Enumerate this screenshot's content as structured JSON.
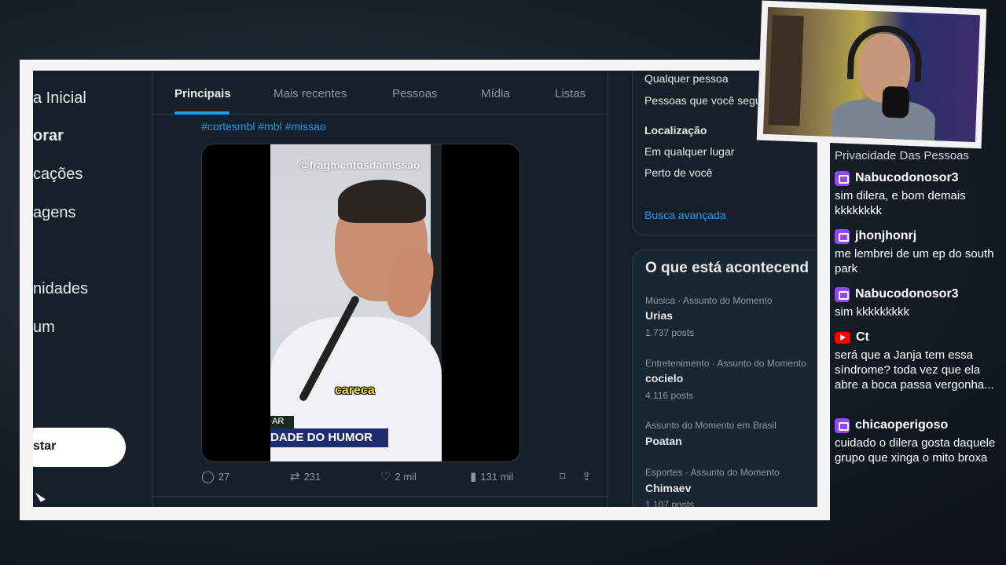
{
  "nav": {
    "items": [
      {
        "label": "a Inicial"
      },
      {
        "label": "orar"
      },
      {
        "label": "cações"
      },
      {
        "label": "agens"
      },
      {
        "label": "nidades"
      },
      {
        "label": "um"
      }
    ],
    "post_label": "star"
  },
  "tabs": [
    {
      "label": "Principais"
    },
    {
      "label": "Mais recentes"
    },
    {
      "label": "Pessoas"
    },
    {
      "label": "Mídia"
    },
    {
      "label": "Listas"
    }
  ],
  "post": {
    "hashtags": "#cortesmbl #mbl #missao",
    "video": {
      "watermark": "@fragmentosdamissao",
      "caption": "careca",
      "lower_small": "AR",
      "lower_bar": "DADE DO HUMOR"
    },
    "replies": "27",
    "reposts": "231",
    "likes": "2 mil",
    "views": "131 mil"
  },
  "filters": {
    "people_any": "Qualquer pessoa",
    "people_follow": "Pessoas que você segu",
    "location_heading": "Localização",
    "location_any": "Em qualquer lugar",
    "location_near": "Perto de você",
    "advanced": "Busca avançada"
  },
  "trends": {
    "title": "O que está acontecend",
    "items": [
      {
        "meta": "Música · Assunto do Momento",
        "name": "Urias",
        "count": "1.737 posts"
      },
      {
        "meta": "Entretenimento · Assunto do Momento",
        "name": "cocielo",
        "count": "4.116 posts"
      },
      {
        "meta": "Assunto do Momento em Brasil",
        "name": "Poatan",
        "count": ""
      },
      {
        "meta": "Esportes · Assunto do Momento",
        "name": "Chimaev",
        "count": "1.107 posts"
      }
    ]
  },
  "chat": {
    "cut_line": "Privacidade Das Pessoas",
    "messages": [
      {
        "author": "Nabucodonosor3",
        "text": "sim dilera, e bom demais kkkkkkkk",
        "platform": "twitch"
      },
      {
        "author": "jhonjhonrj",
        "text": "me lembrei de um ep do south park",
        "platform": "twitch"
      },
      {
        "author": "Nabucodonosor3",
        "text": "sim kkkkkkkkk",
        "platform": "twitch"
      },
      {
        "author": "Ct",
        "text": "será que a Janja tem essa síndrome? toda vez que ela abre a boca passa vergonha...",
        "platform": "youtube"
      },
      {
        "author": "chicaoperigoso",
        "text": "cuidado o dilera gosta daquele grupo que xinga o mito broxa",
        "platform": "twitch"
      }
    ]
  },
  "colors": {
    "accent": "#1d9bf0",
    "background": "#15202b",
    "twitch": "#9146ff",
    "youtube": "#ff0000"
  }
}
